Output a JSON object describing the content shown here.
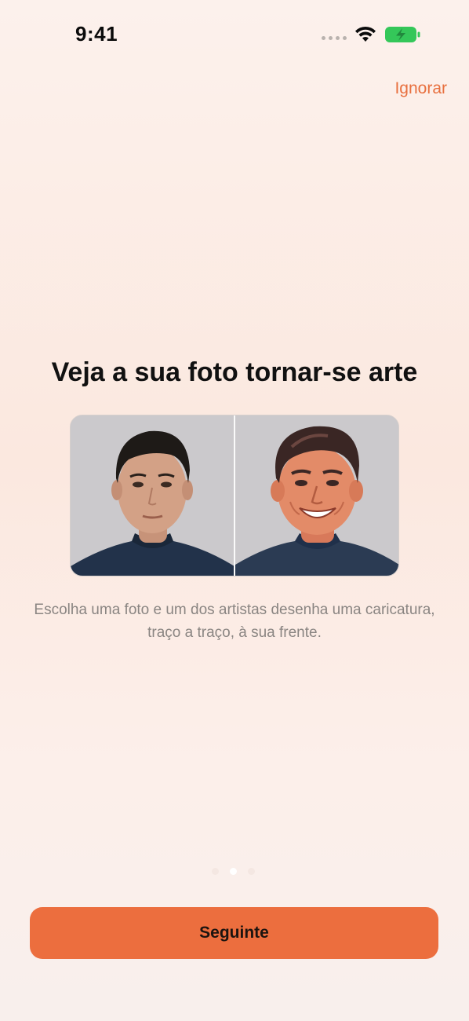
{
  "status_bar": {
    "time": "9:41",
    "icons": [
      "cellular-signal-icon",
      "wifi-icon",
      "battery-charging-icon"
    ]
  },
  "onboarding": {
    "skip_label": "Ignorar",
    "title": "Veja a sua foto tornar-se arte",
    "description": "Escolha uma foto e um dos artistas desenha uma caricatura, traço a traço, à sua frente.",
    "comparison": {
      "left": "original-photo",
      "right": "caricature-illustration"
    },
    "page_indicator": {
      "total": 3,
      "current": 2
    },
    "next_label": "Seguinte"
  },
  "colors": {
    "accent": "#ec6e3e",
    "skip_text": "#e8703f",
    "description_text": "#8a8582",
    "battery": "#34c759"
  }
}
